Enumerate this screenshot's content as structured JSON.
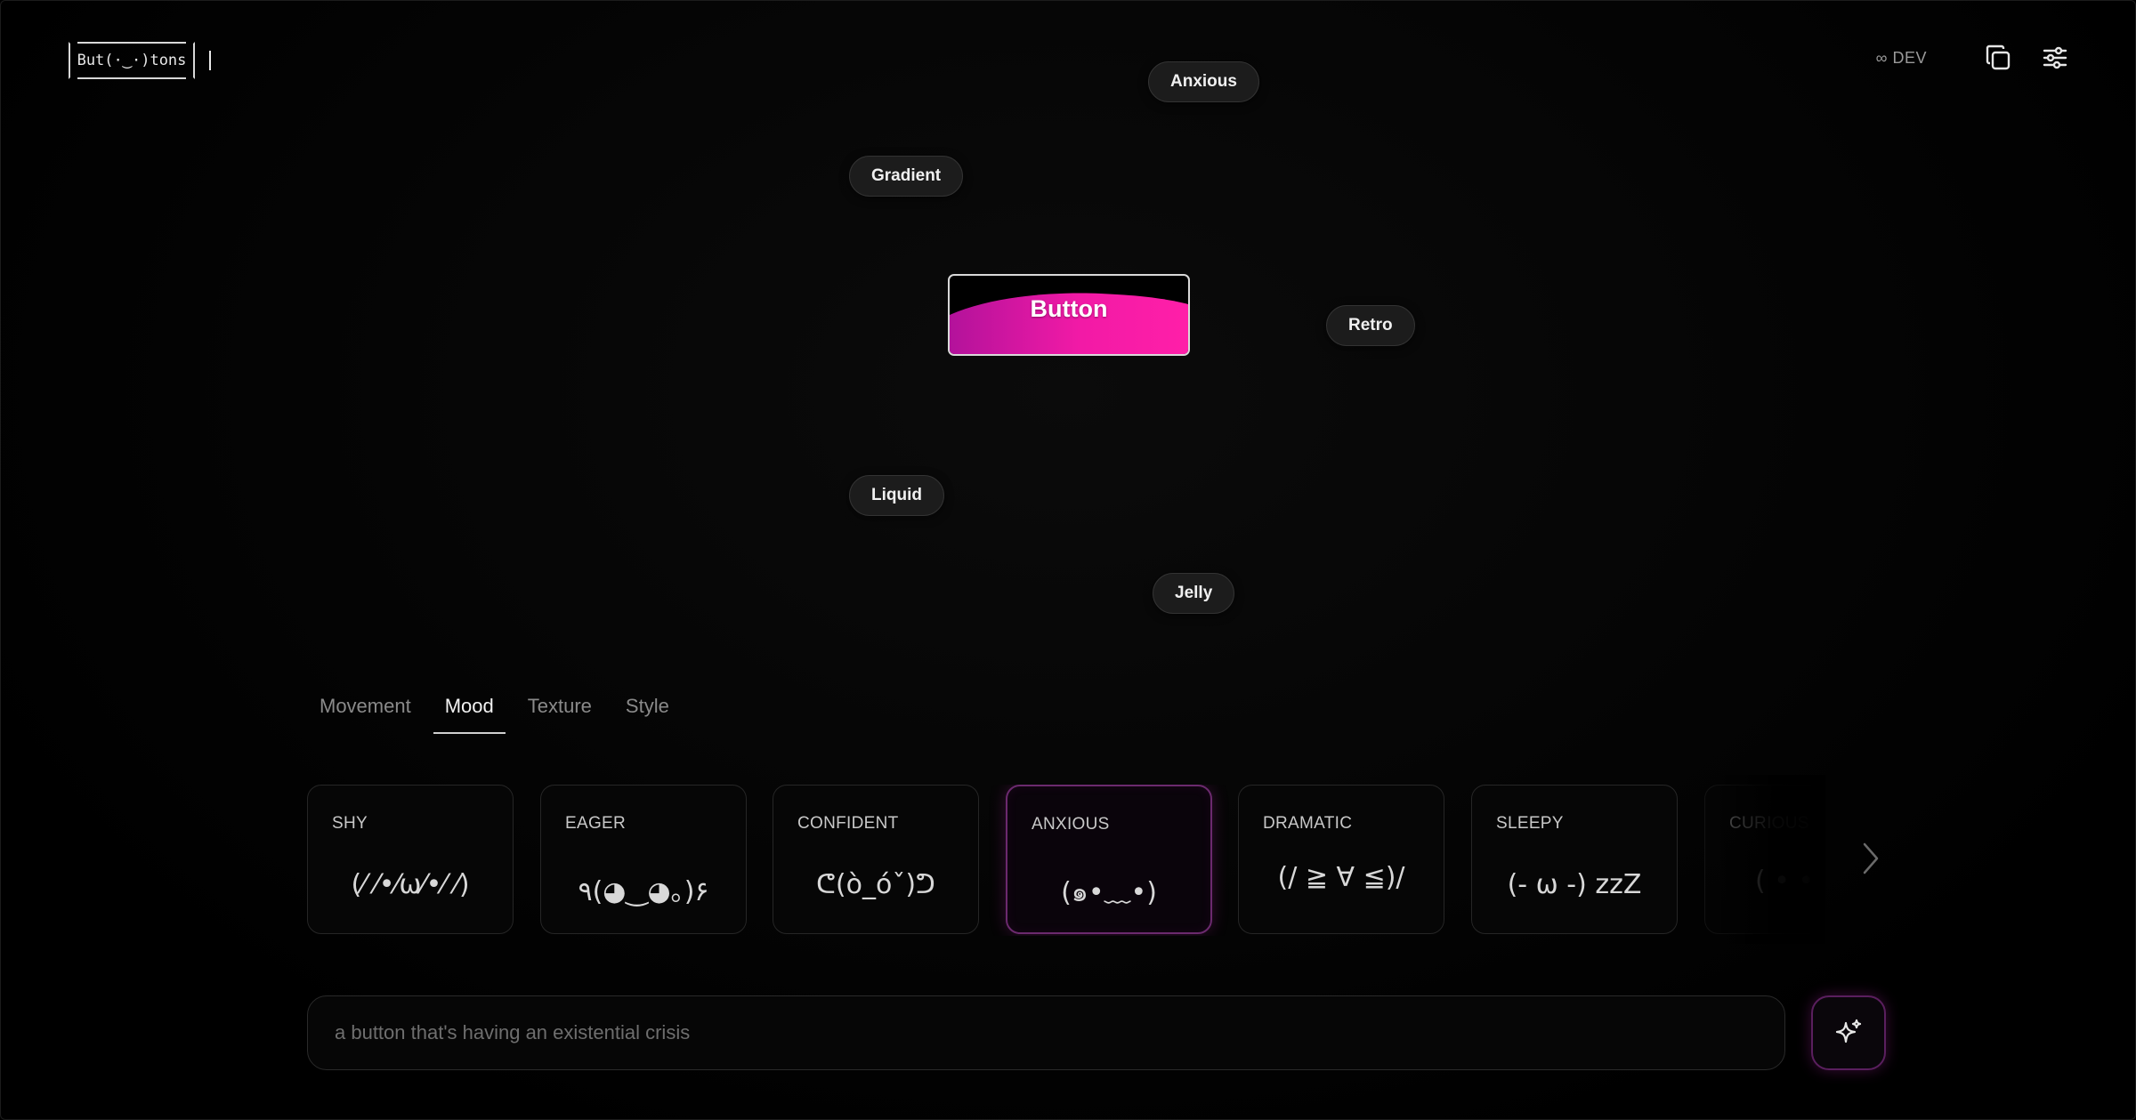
{
  "header": {
    "logo_text": "But(·‿·)tons",
    "dev_badge": "∞ DEV",
    "copy_icon": "copy-icon",
    "settings_icon": "sliders-icon"
  },
  "preview": {
    "button_label": "Button",
    "button_gradient": [
      "#b3129b",
      "#ff1fa8"
    ],
    "chips": [
      {
        "label": "Anxious"
      },
      {
        "label": "Gradient"
      },
      {
        "label": "Retro"
      },
      {
        "label": "Liquid"
      },
      {
        "label": "Jelly"
      }
    ]
  },
  "tabs": [
    {
      "label": "Movement",
      "active": false
    },
    {
      "label": "Mood",
      "active": true
    },
    {
      "label": "Texture",
      "active": false
    },
    {
      "label": "Style",
      "active": false
    }
  ],
  "mood_cards": [
    {
      "title": "SHY",
      "face": "(⁄ ⁄•⁄ω⁄•⁄ ⁄)",
      "selected": false
    },
    {
      "title": "EAGER",
      "face": "٩(◕‿◕｡)۶",
      "selected": false
    },
    {
      "title": "CONFIDENT",
      "face": "ᕦ(ò_óˇ)ᕤ",
      "selected": false
    },
    {
      "title": "ANXIOUS",
      "face": "(๑•﹏•)",
      "selected": true
    },
    {
      "title": "DRAMATIC",
      "face": "(/ ≧ ∀ ≦)/",
      "selected": false
    },
    {
      "title": "SLEEPY",
      "face": "(- ω -) zzZ",
      "selected": false
    },
    {
      "title": "CURIOUS",
      "face": "( •  •",
      "selected": false
    }
  ],
  "carousel": {
    "next_icon": "chevron-right-icon"
  },
  "prompt": {
    "placeholder": "a button that's having an existential crisis",
    "value": "",
    "generate_icon": "sparkle-icon"
  },
  "colors": {
    "accent": "#ff1fa8",
    "accent_dark": "#b3129b",
    "selected_border": "#6b2a6e",
    "background": "#000000"
  }
}
